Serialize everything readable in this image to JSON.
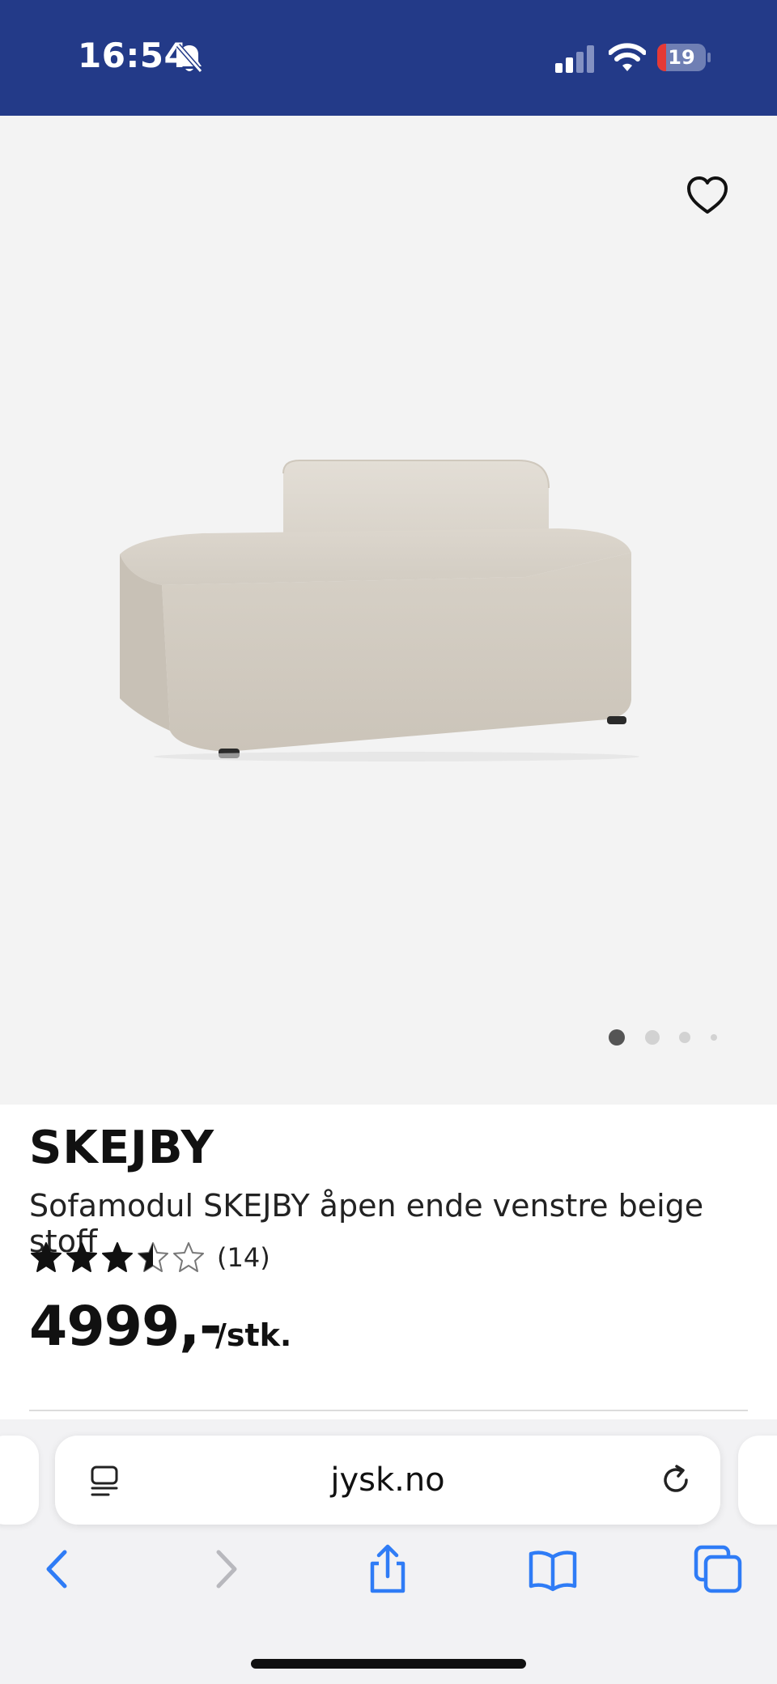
{
  "status_bar": {
    "time": "16:54",
    "battery_level": "19",
    "battery_fraction": 0.19,
    "icons": [
      "bell-slash-icon",
      "cellular-signal-icon",
      "wifi-icon",
      "battery-icon"
    ],
    "background_color": "#233a88"
  },
  "gallery": {
    "image": "sofa-module-photo",
    "favorite_icon": "heart-outline-icon",
    "dots_total": 4,
    "active_dot": 0
  },
  "product": {
    "brand": "SKEJBY",
    "name": "Sofamodul SKEJBY åpen ende venstre beige stoff",
    "rating_value": 3.5,
    "rating_max": 5,
    "rating_count": "(14)",
    "price": "4999,-",
    "unit": "/stk."
  },
  "browser": {
    "url": "jysk.no",
    "toolbar": [
      "back-icon",
      "forward-icon",
      "share-icon",
      "bookmarks-icon",
      "tabs-icon"
    ],
    "accent_color": "#2f7cf6"
  }
}
